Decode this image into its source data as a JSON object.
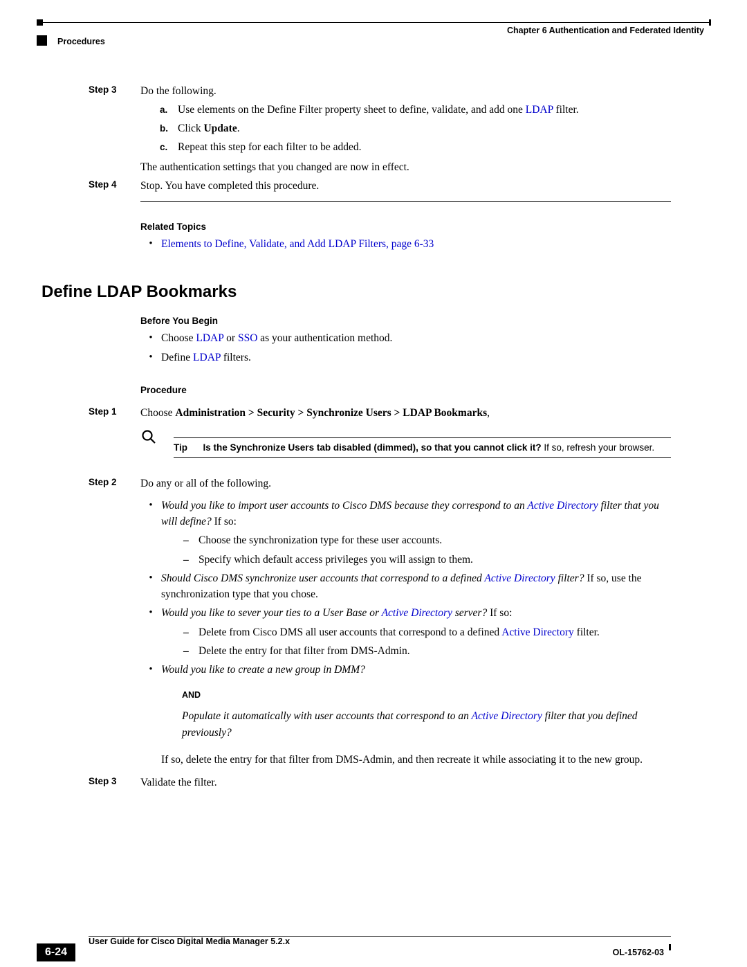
{
  "header": {
    "chapter": "Chapter 6      Authentication and Federated Identity",
    "section": "Procedures"
  },
  "step3": {
    "label": "Step 3",
    "text": "Do the following.",
    "a_letter": "a.",
    "a_pre": "Use elements on the Define Filter property sheet to define, validate, and add one ",
    "a_link": "LDAP",
    "a_post": " filter.",
    "b_letter": "b.",
    "b_pre": "Click ",
    "b_bold": "Update",
    "b_post": ".",
    "c_letter": "c.",
    "c_text": "Repeat this step for each filter to be added.",
    "after": "The authentication settings that you changed are now in effect."
  },
  "step4": {
    "label": "Step 4",
    "text": "Stop. You have completed this procedure."
  },
  "related": {
    "heading": "Related Topics",
    "item1": "Elements to Define, Validate, and Add LDAP Filters, page 6-33"
  },
  "h2": "Define LDAP Bookmarks",
  "before": {
    "heading": "Before You Begin",
    "b1_pre": "Choose ",
    "b1_link1": "LDAP",
    "b1_mid": " or ",
    "b1_link2": "SSO",
    "b1_post": " as your authentication method.",
    "b2_pre": "Define ",
    "b2_link": "LDAP",
    "b2_post": " filters."
  },
  "procedure": {
    "heading": "Procedure"
  },
  "p_step1": {
    "label": "Step 1",
    "pre": "Choose ",
    "bold": "Administration > Security > Synchronize Users > LDAP Bookmarks",
    "post": ","
  },
  "tip": {
    "label": "Tip",
    "bold": "Is the Synchronize Users tab disabled (dimmed), so that you cannot click it?",
    "plain": " If so, refresh your browser."
  },
  "p_step2": {
    "label": "Step 2",
    "text": "Do any or all of the following.",
    "q1_pre": "Would you like to import user accounts to Cisco DMS because they correspond to an ",
    "q1_link": "Active Directory",
    "q1_post_it": " filter that you will define?",
    "q1_post": " If so:",
    "q1_d1": "Choose the synchronization type for these user accounts.",
    "q1_d2": "Specify which default access privileges you will assign to them.",
    "q2_pre": "Should Cisco DMS synchronize user accounts that correspond to a defined ",
    "q2_link": "Active Directory",
    "q2_post_it": " filter?",
    "q2_post": " If so, use the synchronization type that you chose.",
    "q3_pre": "Would you like to sever your ties to a User Base or ",
    "q3_link": "Active Directory",
    "q3_post_it": " server?",
    "q3_post": " If so:",
    "q3_d1_pre": "Delete from Cisco DMS all user accounts that correspond to a defined ",
    "q3_d1_link": "Active Directory",
    "q3_d1_post": " filter.",
    "q3_d2": "Delete the entry for that filter from DMS-Admin.",
    "q4": "Would you like to create a new group in DMM?",
    "and": "AND",
    "q4b_pre": "Populate it automatically with user accounts that correspond to an ",
    "q4b_link": "Active Directory",
    "q4b_post": " filter that you defined previously?",
    "q4c": "If so, delete the entry for that filter from DMS-Admin, and then recreate it while associating it to the new group."
  },
  "p_step3": {
    "label": "Step 3",
    "text": "Validate the filter."
  },
  "footer": {
    "title": "User Guide for Cisco Digital Media Manager 5.2.x",
    "docid": "OL-15762-03",
    "page": "6-24"
  }
}
